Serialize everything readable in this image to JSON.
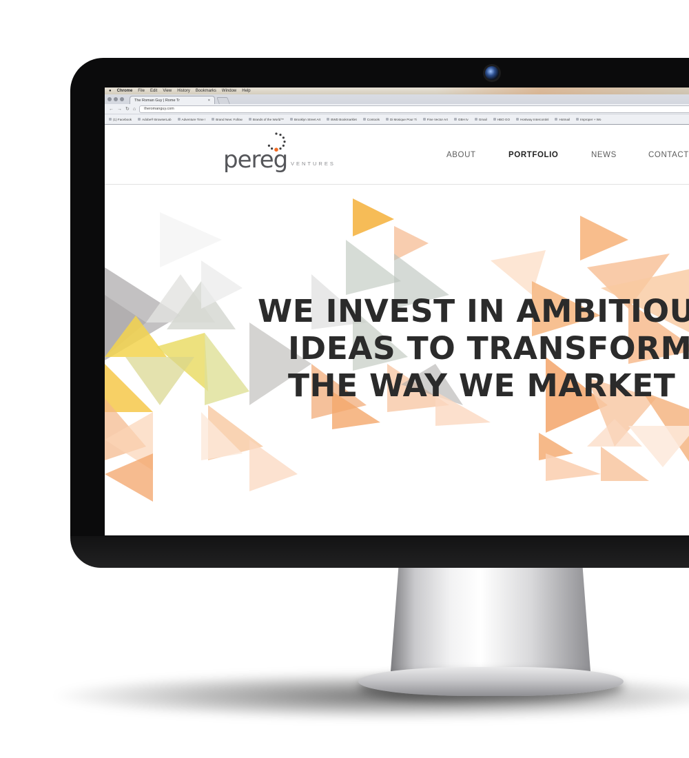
{
  "mac_menubar": {
    "items": [
      "Chrome",
      "File",
      "Edit",
      "View",
      "History",
      "Bookmarks",
      "Window",
      "Help"
    ]
  },
  "browser": {
    "tab_title": "The Roman Guy | Rome Tr",
    "tab_close": "×",
    "url": "theromanguy.com",
    "bookmarks": [
      "(1) Facebook",
      "Adobe® BrowserLab",
      "Adventure Time !",
      "Brand New: Follow",
      "Brands of the World™",
      "Brooklyn Street Art",
      "BWD Bookmarklet",
      "Contools",
      "Di Mosique Pour Ti",
      "Fine Vector Art",
      "GBH tv",
      "Gmail",
      "HBO GO",
      "Hostway Intercontinl",
      "Hotmail",
      "Improper + Wo"
    ]
  },
  "site": {
    "logo": {
      "wordmark": "pereg",
      "tagline": "VENTURES",
      "accent_color": "#f26a21",
      "dot_color": "#3d3d3f"
    },
    "nav": [
      {
        "label": "ABOUT",
        "active": false
      },
      {
        "label": "PORTFOLIO",
        "active": true
      },
      {
        "label": "NEWS",
        "active": false
      },
      {
        "label": "CONTACT",
        "active": false
      }
    ],
    "hero": {
      "line1": "WE INVEST IN AMBITIOUS",
      "line2": "IDEAS TO TRANSFORM",
      "line3": "THE WAY WE MARKET",
      "palette": [
        "#f5a868",
        "#f7c36a",
        "#e8d86a",
        "#b7b6b8",
        "#cfd7cc",
        "#fbd8c0"
      ]
    }
  },
  "device": {
    "bezel_color": "#0b0b0c",
    "stand_color": "#d9d9db"
  }
}
